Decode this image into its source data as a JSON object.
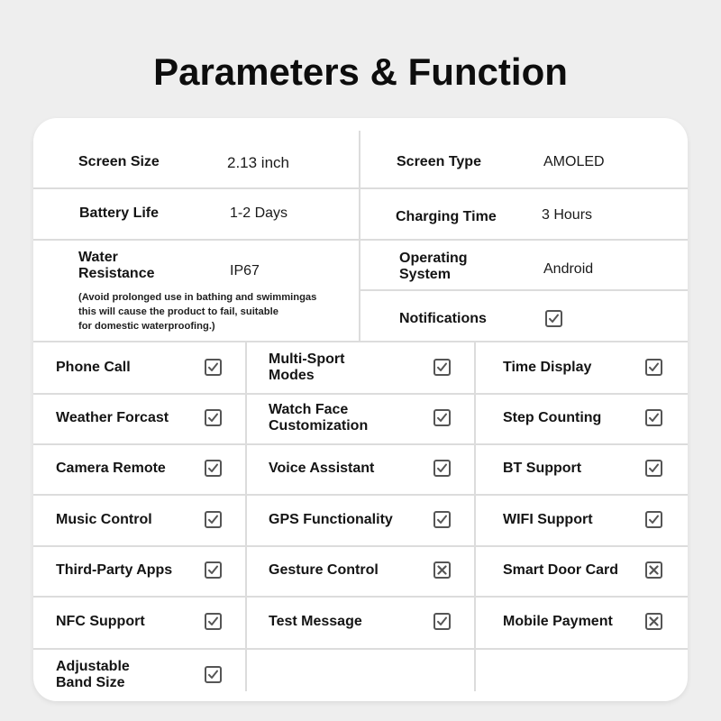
{
  "title": "Parameters & Function",
  "specs": {
    "screen_size": {
      "label": "Screen Size",
      "value": "2.13 inch"
    },
    "screen_type": {
      "label": "Screen Type",
      "value": "AMOLED"
    },
    "battery_life": {
      "label": "Battery Life",
      "value": "1-2 Days"
    },
    "charging_time": {
      "label": "Charging Time",
      "value": "3 Hours"
    },
    "water_resistance": {
      "label_line1": "Water",
      "label_line2": "Resistance",
      "value": "IP67",
      "note_line1": "(Avoid prolonged use in bathing and swimmingas",
      "note_line2": "this will cause the product to fail, suitable",
      "note_line3": "for domestic waterproofing.)"
    },
    "operating_system": {
      "label_line1": "Operating",
      "label_line2": "System",
      "value": "Android"
    },
    "notifications": {
      "label": "Notifications",
      "status": "check"
    }
  },
  "features": [
    {
      "label_line1": "Phone Call",
      "label_line2": "",
      "status": "check"
    },
    {
      "label_line1": "Multi-Sport",
      "label_line2": "Modes",
      "status": "check"
    },
    {
      "label_line1": "Time Display",
      "label_line2": "",
      "status": "check"
    },
    {
      "label_line1": "Weather Forcast",
      "label_line2": "",
      "status": "check"
    },
    {
      "label_line1": "Watch Face",
      "label_line2": "Customization",
      "status": "check"
    },
    {
      "label_line1": "Step Counting",
      "label_line2": "",
      "status": "check"
    },
    {
      "label_line1": "Camera Remote",
      "label_line2": "",
      "status": "check"
    },
    {
      "label_line1": "Voice Assistant",
      "label_line2": "",
      "status": "check"
    },
    {
      "label_line1": "BT Support",
      "label_line2": "",
      "status": "check"
    },
    {
      "label_line1": "Music Control",
      "label_line2": "",
      "status": "check"
    },
    {
      "label_line1": "GPS Functionality",
      "label_line2": "",
      "status": "check"
    },
    {
      "label_line1": "WIFI Support",
      "label_line2": "",
      "status": "check"
    },
    {
      "label_line1": "Third-Party Apps",
      "label_line2": "",
      "status": "check"
    },
    {
      "label_line1": "Gesture Control",
      "label_line2": "",
      "status": "cross"
    },
    {
      "label_line1": "Smart Door Card",
      "label_line2": "",
      "status": "cross"
    },
    {
      "label_line1": "NFC Support",
      "label_line2": "",
      "status": "check"
    },
    {
      "label_line1": "Test Message",
      "label_line2": "",
      "status": "check"
    },
    {
      "label_line1": "Mobile Payment",
      "label_line2": "",
      "status": "cross"
    },
    {
      "label_line1": "Adjustable",
      "label_line2": "Band Size",
      "status": "check"
    }
  ],
  "icons": {
    "check": "checkbox-checked-icon",
    "cross": "checkbox-crossed-icon"
  },
  "colors": {
    "background": "#eeeeee",
    "card": "#ffffff",
    "divider": "#dcdcdc",
    "text": "#141414",
    "icon_border": "#555555"
  }
}
